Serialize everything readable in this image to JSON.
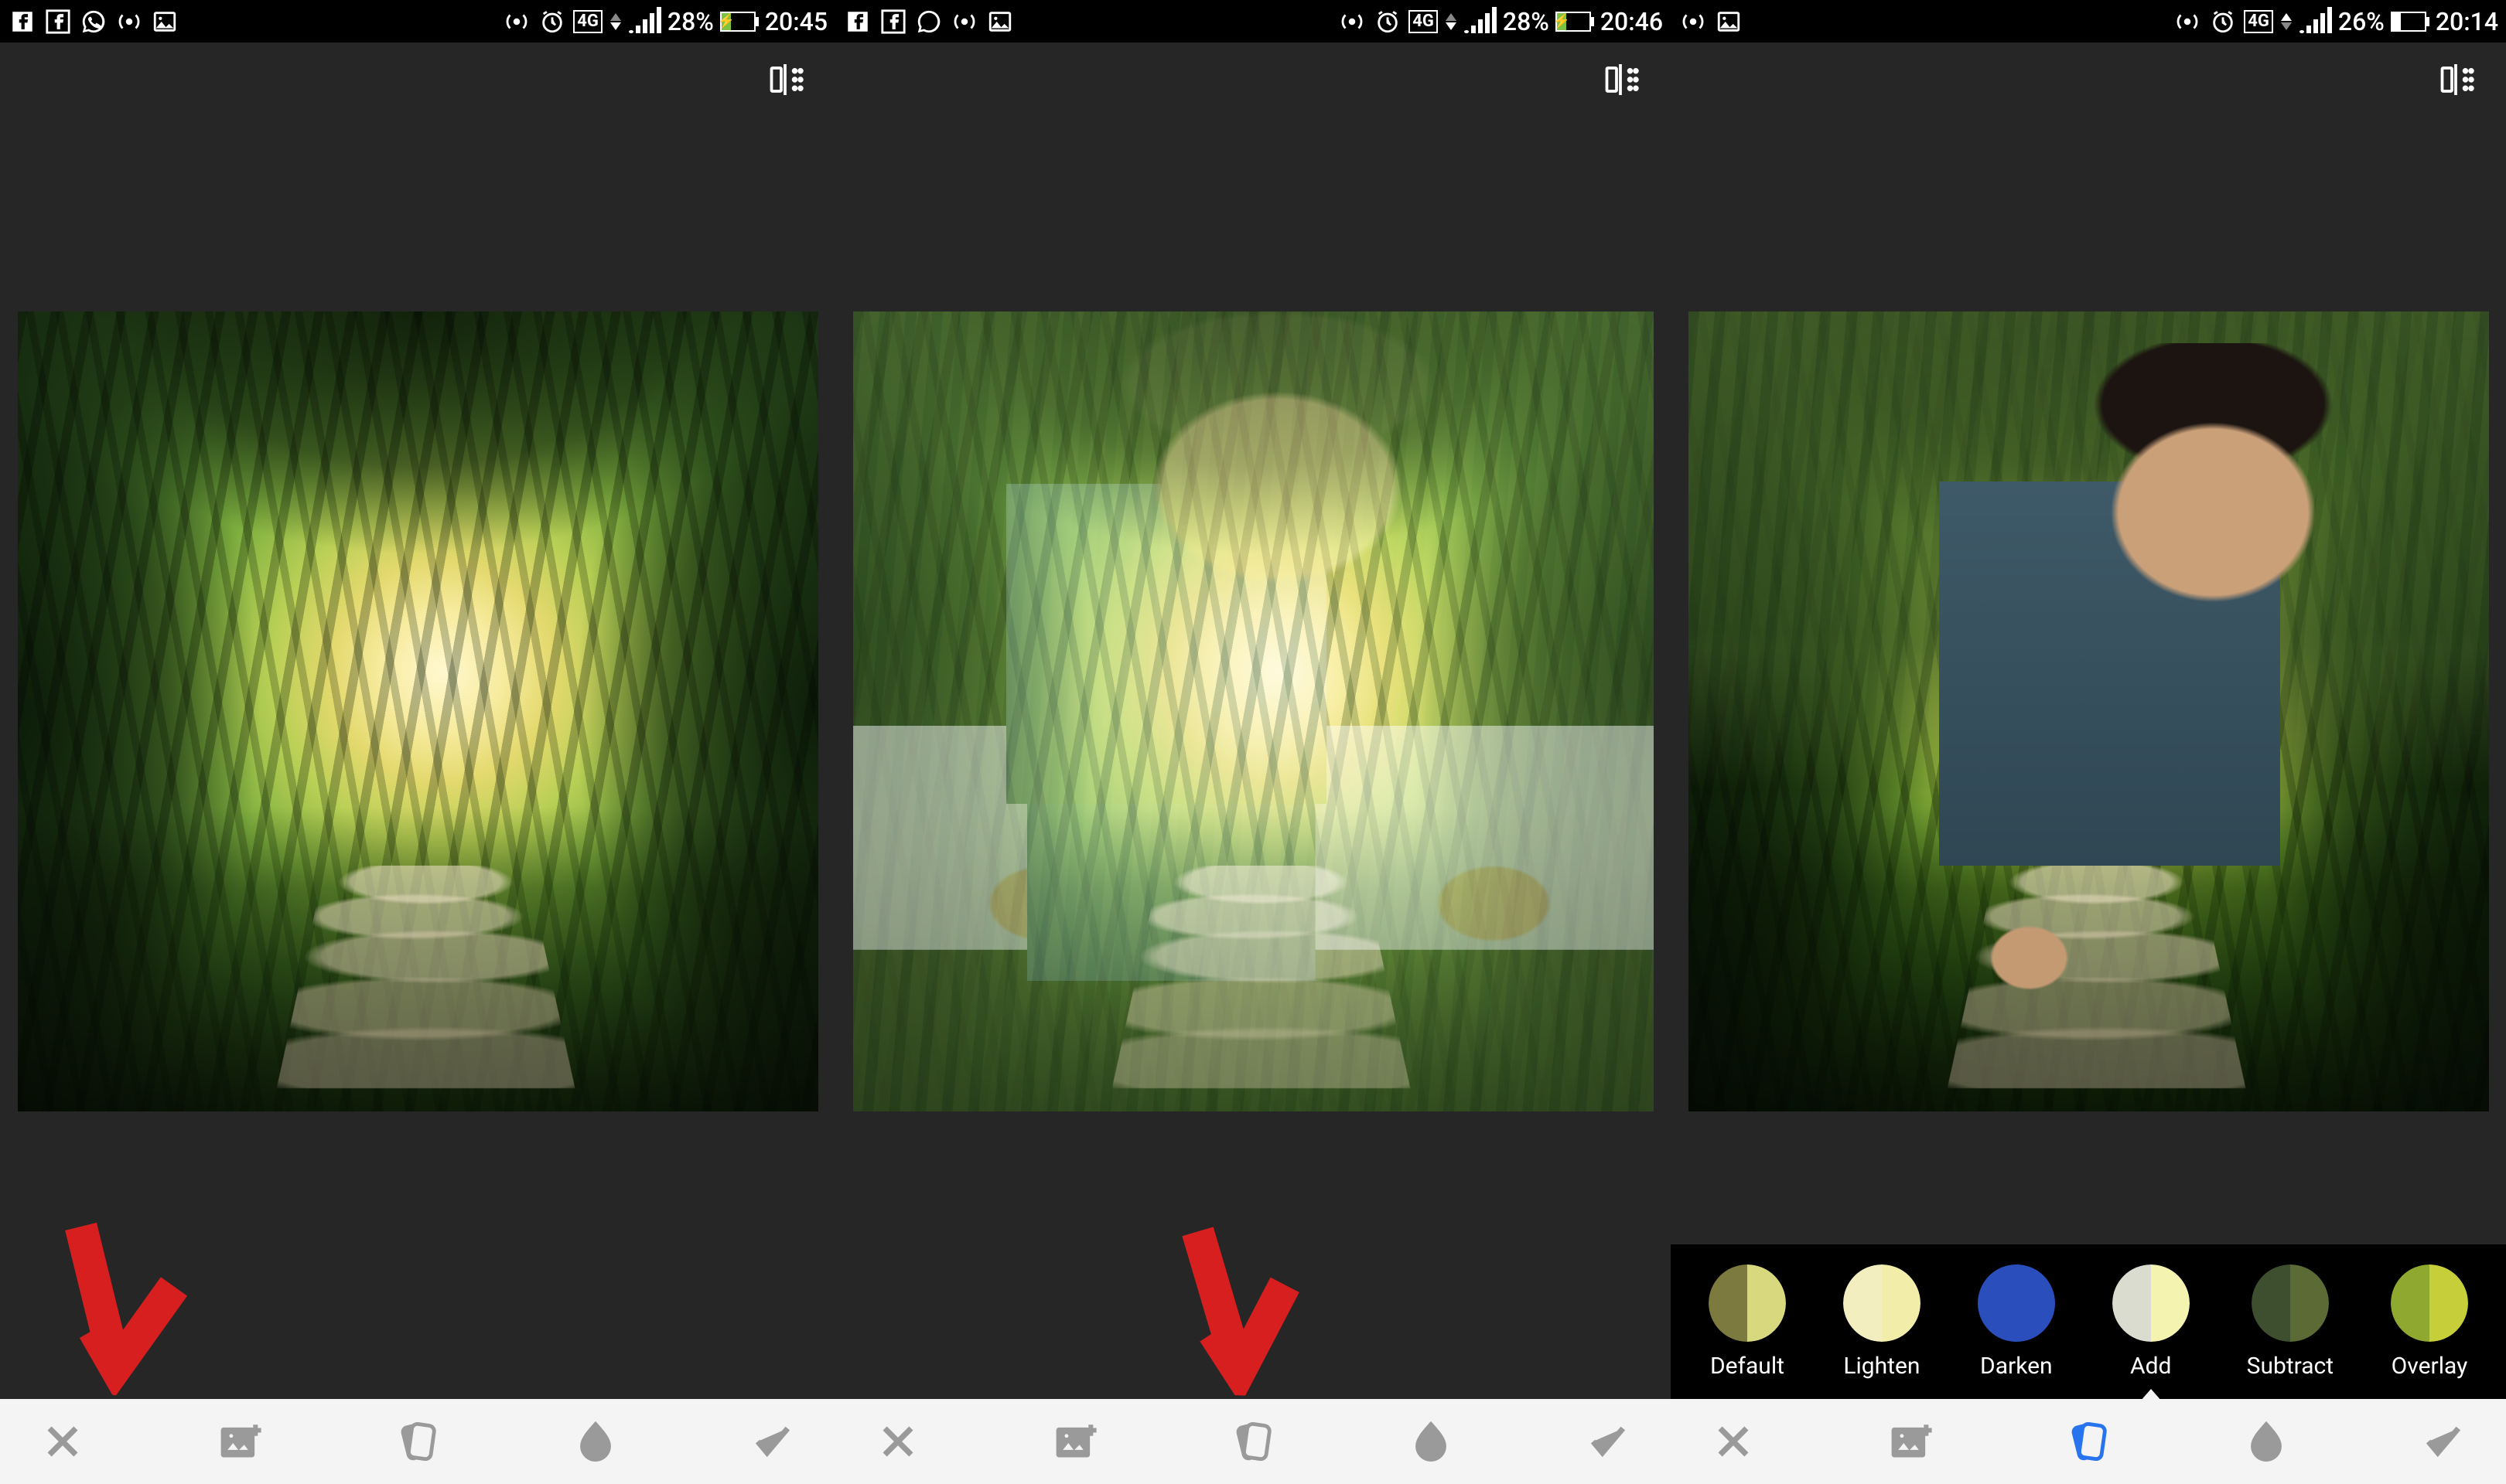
{
  "screens": [
    {
      "status": {
        "battery_pct": "28%",
        "time": "20:45",
        "network": "4G",
        "charging": true
      },
      "highlight_tool": "add-image"
    },
    {
      "status": {
        "battery_pct": "28%",
        "time": "20:46",
        "network": "4G",
        "charging": true
      },
      "highlight_tool": "styles"
    },
    {
      "status": {
        "battery_pct": "26%",
        "time": "20:14",
        "network": "4G",
        "charging": false
      },
      "blend_selected": "Add"
    }
  ],
  "blend_modes": [
    {
      "label": "Default",
      "left": "#7d7a3f",
      "right": "#d8d87e"
    },
    {
      "label": "Lighten",
      "left": "#f2eec0",
      "right": "#f2eeaa"
    },
    {
      "label": "Darken",
      "left": "#2a4fbd",
      "right": "#2a4fbd"
    },
    {
      "label": "Add",
      "left": "#d9dccf",
      "right": "#f4f3b0"
    },
    {
      "label": "Subtract",
      "left": "#3d4f2e",
      "right": "#5c6a35"
    },
    {
      "label": "Overlay",
      "left": "#8fa82f",
      "right": "#c6cf3a"
    }
  ],
  "toolbar": {
    "cancel": "cancel",
    "add_image": "add-image",
    "styles": "styles",
    "opacity": "opacity",
    "accept": "accept"
  }
}
